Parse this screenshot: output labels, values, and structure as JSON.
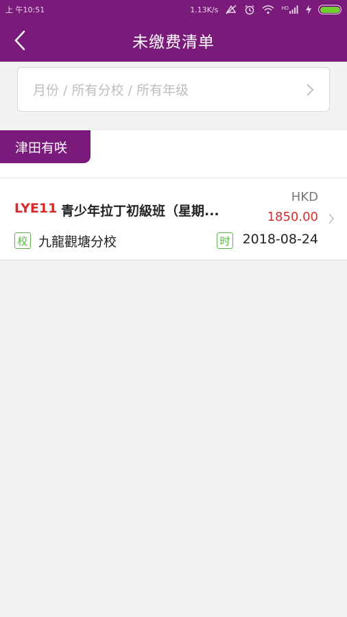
{
  "status_bar": {
    "time": "上 午10:51",
    "network_speed": "1.13K/s",
    "signal_label": "HD",
    "colors": {
      "battery": "#6fcf2f"
    }
  },
  "header": {
    "title": "未缴费清单",
    "back_icon": "chevron-left-icon",
    "background": "#7a1a7b"
  },
  "filter": {
    "placeholder": "月份 / 所有分校 / 所有年级",
    "chevron_icon": "chevron-right-icon"
  },
  "section": {
    "student_name": "津田有咲"
  },
  "bills": [
    {
      "code": "LYE11",
      "course_name": "青少年拉丁初級班（星期...",
      "currency": "HKD",
      "amount": "1850.00",
      "school_badge": "校",
      "school": "九龍觀塘分校",
      "time_badge": "时",
      "date": "2018-08-24"
    }
  ],
  "colors": {
    "accent": "#7a1a7b",
    "price": "#d92a2a",
    "badge": "#57b545"
  }
}
